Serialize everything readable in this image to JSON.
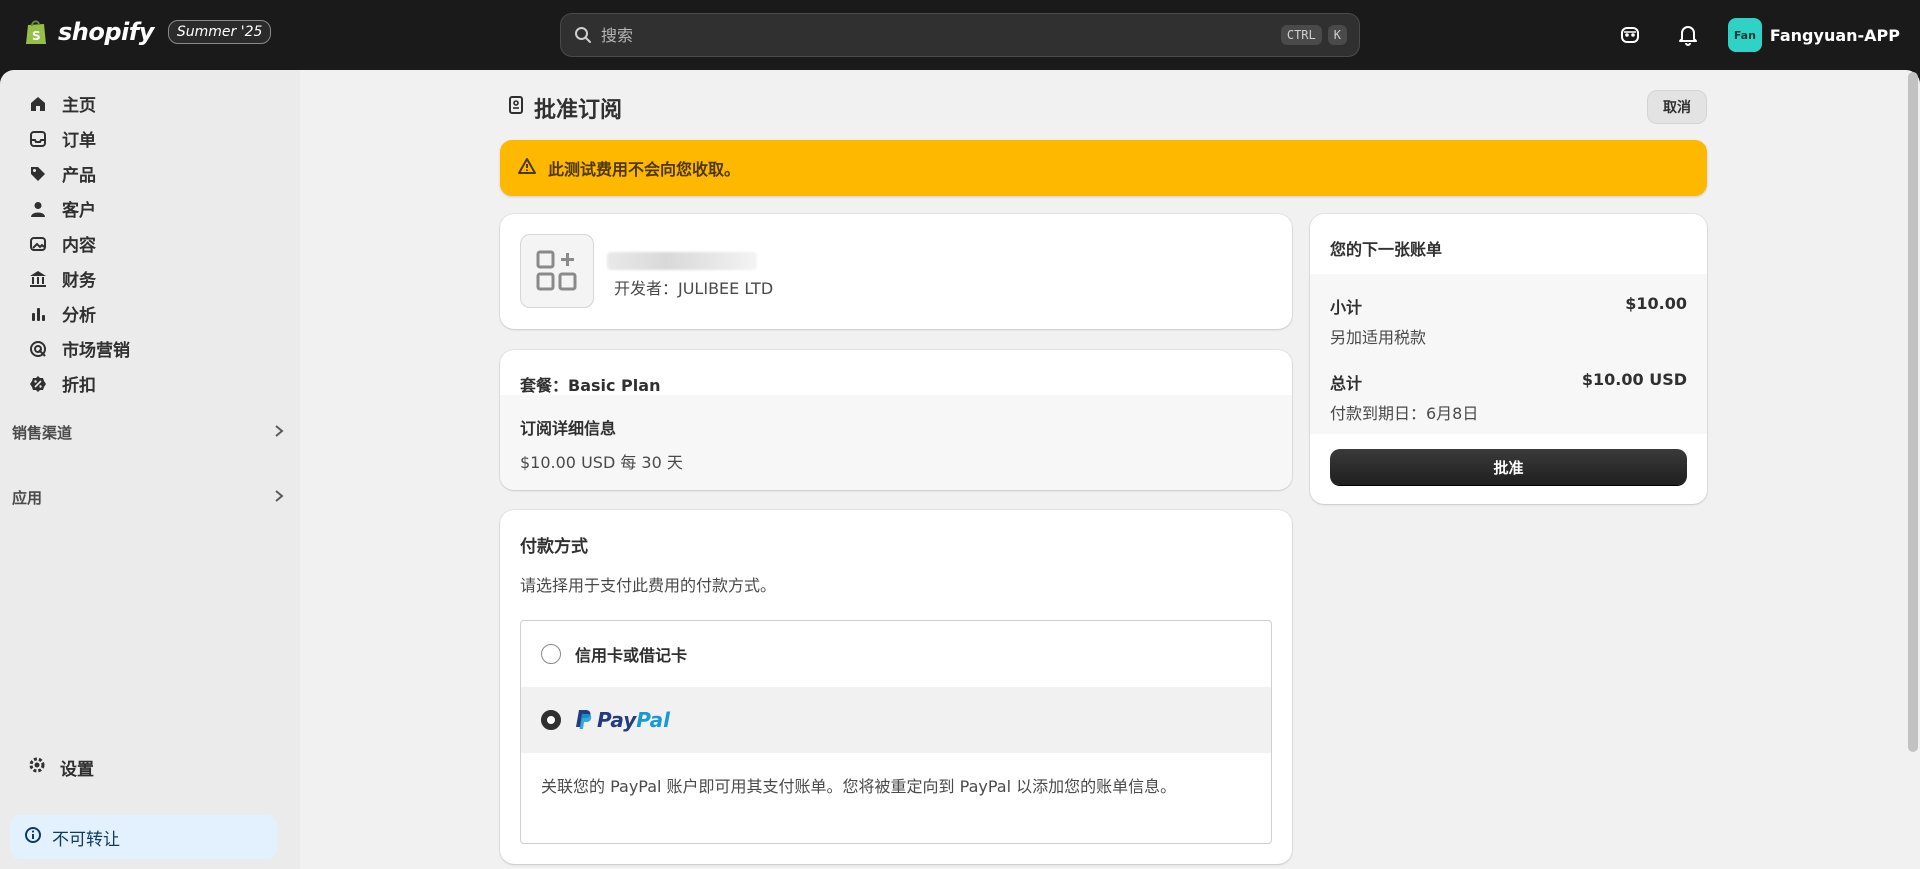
{
  "topbar": {
    "brand": "shopify",
    "release_badge": "Summer '25",
    "search_placeholder": "搜索",
    "shortcut_ctrl": "CTRL",
    "shortcut_k": "K",
    "store_avatar": "Fan",
    "store_name": "Fangyuan-APP"
  },
  "sidebar": {
    "items": [
      {
        "label": "主页",
        "icon": "home-icon"
      },
      {
        "label": "订单",
        "icon": "inbox-icon"
      },
      {
        "label": "产品",
        "icon": "tag-icon"
      },
      {
        "label": "客户",
        "icon": "person-icon"
      },
      {
        "label": "内容",
        "icon": "image-icon"
      },
      {
        "label": "财务",
        "icon": "bank-icon"
      },
      {
        "label": "分析",
        "icon": "bar-chart-icon"
      },
      {
        "label": "市场营销",
        "icon": "target-icon"
      },
      {
        "label": "折扣",
        "icon": "discount-icon"
      }
    ],
    "sales_channels": "销售渠道",
    "apps": "应用",
    "settings": "设置",
    "notice": "不可转让"
  },
  "page": {
    "title": "批准订阅",
    "cancel_label": "取消",
    "banner": "此测试费用不会向您收取。"
  },
  "app_card": {
    "developer": "开发者：JULIBEE LTD"
  },
  "plan_card": {
    "plan": "套餐：Basic Plan",
    "details_title": "订阅详细信息",
    "details_value": "$10.00 USD 每 30 天"
  },
  "payment": {
    "title": "付款方式",
    "description": "请选择用于支付此费用的付款方式。",
    "option_card": "信用卡或借记卡",
    "paypal_pay": "Pay",
    "paypal_pal": "Pal",
    "paypal_note": "关联您的 PayPal 账户即可用其支付账单。您将被重定向到 PayPal 以添加您的账单信息。",
    "selected": "paypal"
  },
  "bill": {
    "title": "您的下一张账单",
    "subtotal_label": "小计",
    "subtotal_value": "$10.00",
    "tax_note": "另加适用税款",
    "total_label": "总计",
    "total_value": "$10.00 USD",
    "due_date": "付款到期日：6月8日",
    "approve_label": "批准"
  },
  "colors": {
    "topbar": "#1a1a1a",
    "banner": "#ffb800",
    "notice_bg": "#e2f1fd",
    "avatar": "#2fd3c5"
  }
}
